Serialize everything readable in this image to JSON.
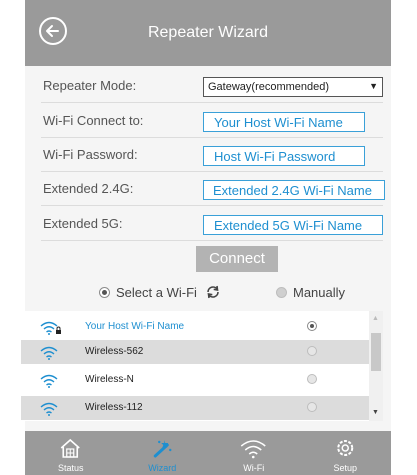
{
  "header": {
    "title": "Repeater Wizard"
  },
  "form": {
    "repeater_mode_label": "Repeater Mode:",
    "repeater_mode_value": "Gateway(recommended)",
    "wifi_connect_label": "Wi-Fi Connect to:",
    "wifi_connect_value": "Your Host Wi-Fi Name",
    "wifi_password_label": "Wi-Fi Password:",
    "wifi_password_value": "Host Wi-Fi Password",
    "ext24_label": "Extended 2.4G:",
    "ext24_value": "Extended 2.4G Wi-Fi Name",
    "ext5_label": "Extended 5G:",
    "ext5_value": "Extended 5G Wi-Fi Name"
  },
  "connect_label": "Connect",
  "modes": {
    "select_label": "Select a Wi-Fi",
    "manual_label": "Manually"
  },
  "wifi_list": [
    {
      "name": "Your Host Wi-Fi Name",
      "selected": true,
      "locked": true
    },
    {
      "name": "Wireless-562",
      "selected": false,
      "locked": false
    },
    {
      "name": "Wireless-N",
      "selected": false,
      "locked": false
    },
    {
      "name": "Wireless-112",
      "selected": false,
      "locked": false
    }
  ],
  "nav": {
    "status": "Status",
    "wizard": "Wizard",
    "wifi": "Wi-Fi",
    "setup": "Setup"
  },
  "colors": {
    "accent": "#1e8fd0",
    "header": "#9a9a9a",
    "button": "#b3b3b3"
  }
}
